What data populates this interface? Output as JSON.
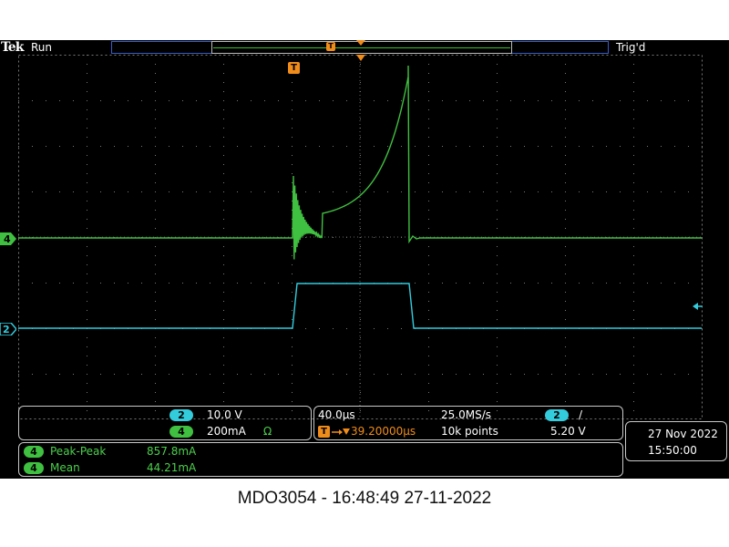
{
  "window": {
    "logo": "Tek",
    "run_state": "Run",
    "trigger_state": "Trig'd",
    "trigger_marker": "T"
  },
  "channels": {
    "ch4": {
      "label": "4",
      "color": "#40c040",
      "scale": "200mA",
      "impedance_symbol": "Ω"
    },
    "ch2": {
      "label": "2",
      "color": "#33ccdd",
      "scale": "10.0 V"
    }
  },
  "timebase": {
    "time_per_div": "40.0µs",
    "sample_rate": "25.0MS/s",
    "trigger_position": "39.20000µs",
    "record_length": "10k points",
    "trigger_source": "2",
    "trigger_slope_symbol": "/",
    "trigger_level": "5.20 V"
  },
  "measurements": [
    {
      "channel": "4",
      "name": "Peak-Peak",
      "value": "857.8mA"
    },
    {
      "channel": "4",
      "name": "Mean",
      "value": "44.21mA"
    }
  ],
  "datetime": {
    "date": "27 Nov 2022",
    "time": "15:50:00"
  },
  "caption": "MDO3054 - 16:48:49   27-11-2022"
}
